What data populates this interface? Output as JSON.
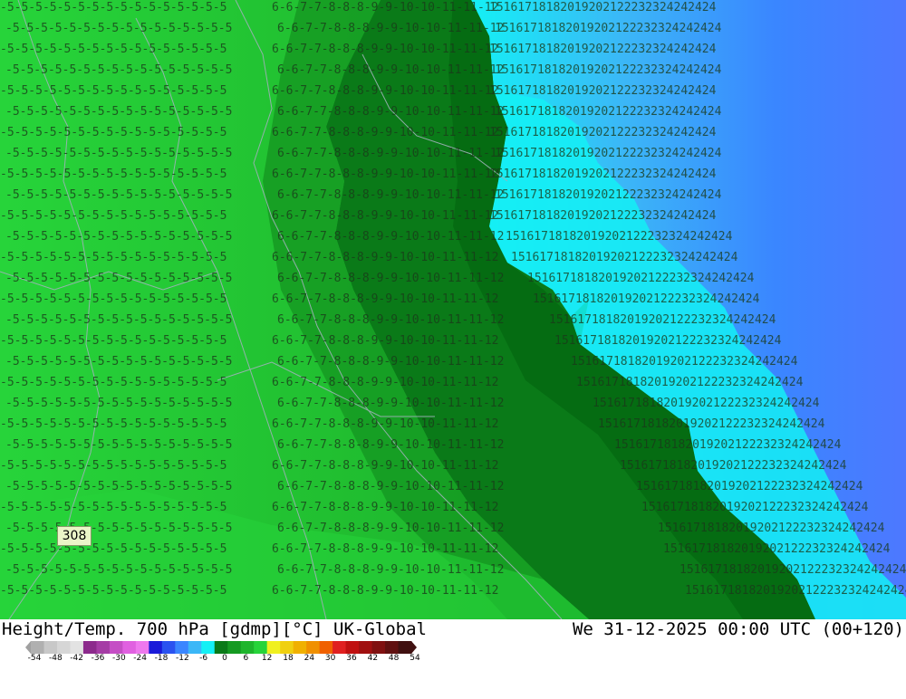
{
  "map": {
    "title": "Height/Temp. 700 hPa [gdmp][°C] UK-Global",
    "valid_time": "We 31-12-2025 00:00 UTC (00+120)",
    "marker_label": "308",
    "colors": {
      "land_green_light": "#27d43a",
      "land_green": "#1eb52c",
      "land_green_mid": "#159a22",
      "land_green_dark": "#0a7a18",
      "land_green_darkest": "#056a12",
      "cyan": "#14f0f5",
      "light_blue": "#3bb7f7",
      "blue": "#3a86ff",
      "blue_far": "#4d78ff",
      "contour_label": "#1a3a1a",
      "border_line": "#9fb0b8"
    },
    "contour_bands": [
      {
        "name": "band-west",
        "labels": "-5-5-5-5-5-5-5-5-5-5-5-5-5-5-5-5"
      },
      {
        "name": "band-mid",
        "labels": "6-6-7-7-8-8-8-9-9-10-10-11-11-12"
      },
      {
        "name": "band-east",
        "labels": "15161718182019202122232324242424"
      }
    ]
  },
  "legend": {
    "colors": [
      "#b0b0b0",
      "#c8c8c8",
      "#d6d6d6",
      "#e3e3e3",
      "#8c2a8c",
      "#a53ca5",
      "#c54ec5",
      "#e060e0",
      "#ee78ee",
      "#1a1ad9",
      "#2a52f0",
      "#3a86ff",
      "#3bb7f7",
      "#14f0f5",
      "#0a7a18",
      "#159a22",
      "#1eb52c",
      "#27d43a",
      "#f0f020",
      "#f0d010",
      "#f0b000",
      "#f09000",
      "#f06000",
      "#e02020",
      "#c01010",
      "#a01010",
      "#801010",
      "#601010",
      "#401010"
    ],
    "ticks": [
      "-54",
      "-48",
      "-42",
      "-36",
      "-30",
      "-24",
      "-18",
      "-12",
      "-6",
      "0",
      "6",
      "12",
      "18",
      "24",
      "30",
      "36",
      "42",
      "48",
      "54"
    ]
  }
}
